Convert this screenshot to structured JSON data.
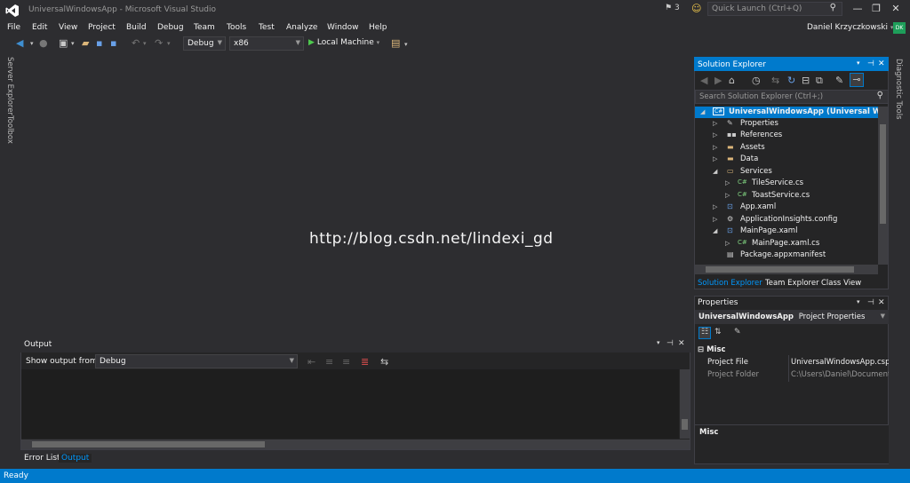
{
  "window": {
    "title": "UniversalWindowsApp - Microsoft Visual Studio",
    "notifications": "3",
    "quick_launch_placeholder": "Quick Launch (Ctrl+Q)",
    "minimize": "—",
    "restore": "❐",
    "close": "✕"
  },
  "menu": [
    "File",
    "Edit",
    "View",
    "Project",
    "Build",
    "Debug",
    "Team",
    "Tools",
    "Test",
    "Analyze",
    "Window",
    "Help"
  ],
  "user": {
    "name": "Daniel Krzyczkowski",
    "initials": "DK"
  },
  "toolbar": {
    "config": "Debug",
    "platform": "x86",
    "run_target": "Local Machine"
  },
  "side_tabs": {
    "server_explorer": "Server Explorer",
    "toolbox": "Toolbox",
    "diagnostic_tools": "Diagnostic Tools"
  },
  "watermark": "http://blog.csdn.net/lindexi_gd",
  "output": {
    "title": "Output",
    "show_from_label": "Show output from:",
    "source": "Debug",
    "tabs": [
      "Error List",
      "Output"
    ]
  },
  "solution_explorer": {
    "title": "Solution Explorer",
    "search_placeholder": "Search Solution Explorer (Ctrl+;)",
    "items": [
      {
        "label": "UniversalWindowsApp (Universal Windo",
        "icon": "csharp-project-icon"
      },
      {
        "label": "Properties",
        "icon": "wrench-icon"
      },
      {
        "label": "References",
        "icon": "references-icon"
      },
      {
        "label": "Assets",
        "icon": "folder-icon"
      },
      {
        "label": "Data",
        "icon": "folder-icon"
      },
      {
        "label": "Services",
        "icon": "folder-open-icon"
      },
      {
        "label": "TileService.cs",
        "icon": "csharp-file-icon"
      },
      {
        "label": "ToastService.cs",
        "icon": "csharp-file-icon"
      },
      {
        "label": "App.xaml",
        "icon": "xaml-icon"
      },
      {
        "label": "ApplicationInsights.config",
        "icon": "config-icon"
      },
      {
        "label": "MainPage.xaml",
        "icon": "xaml-icon"
      },
      {
        "label": "MainPage.xaml.cs",
        "icon": "csharp-file-icon"
      },
      {
        "label": "Package.appxmanifest",
        "icon": "manifest-icon"
      }
    ],
    "tabs": [
      "Solution Explorer",
      "Team Explorer",
      "Class View"
    ]
  },
  "properties": {
    "title": "Properties",
    "object_name": "UniversalWindowsApp",
    "object_type": "Project Properties",
    "category": "Misc",
    "rows": [
      {
        "name": "Project File",
        "value": "UniversalWindowsApp.cspro"
      },
      {
        "name": "Project Folder",
        "value": "C:\\Users\\Daniel\\Documents"
      }
    ],
    "description_title": "Misc"
  },
  "status": {
    "text": "Ready"
  },
  "colors": {
    "accent": "#007acc",
    "background": "#2d2d30",
    "run_green": "#4ec94e"
  }
}
